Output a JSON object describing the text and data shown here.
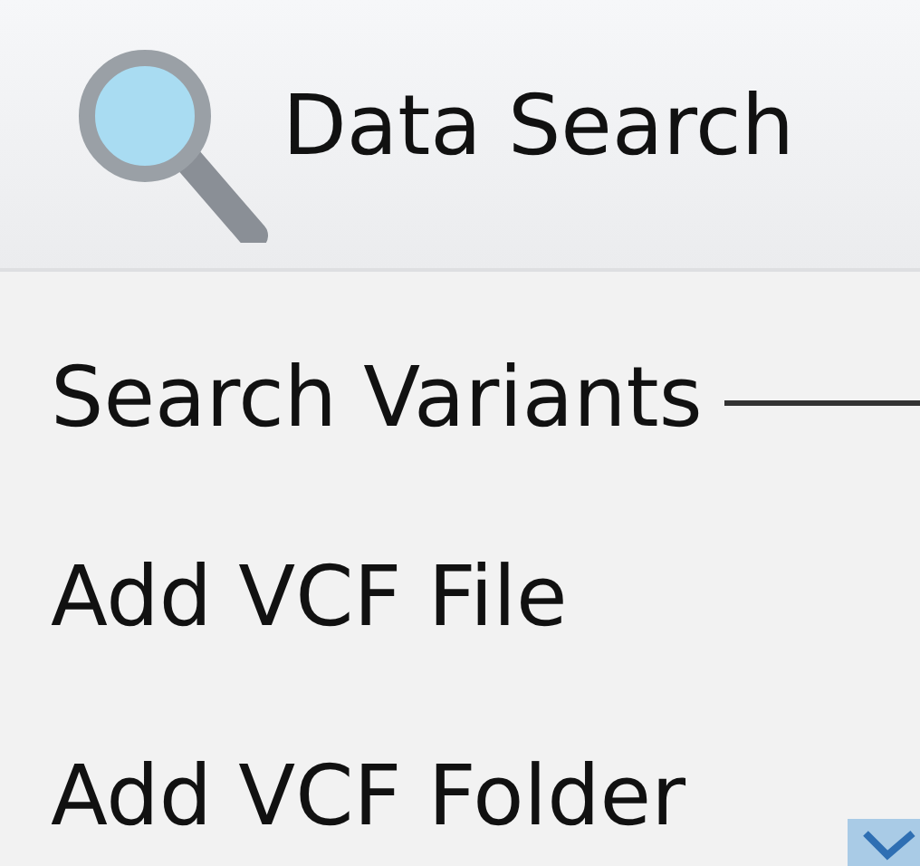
{
  "header": {
    "title": "Data Search"
  },
  "menu_items": [
    {
      "label": "Search Variants"
    },
    {
      "label": "Add VCF File"
    },
    {
      "label": "Add VCF Folder"
    }
  ]
}
